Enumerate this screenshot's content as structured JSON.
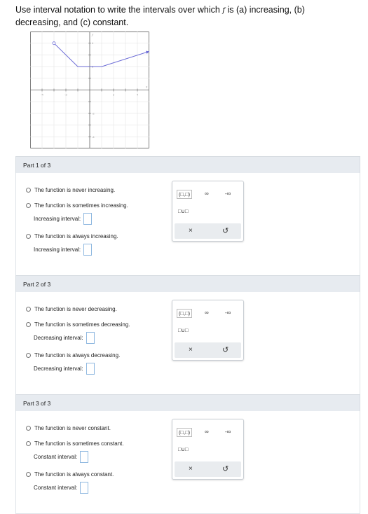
{
  "question": {
    "text_before": "Use interval notation to write the intervals over which ",
    "function_symbol": "f",
    "text_after": " is (a) increasing, (b) decreasing, and (c) constant."
  },
  "graph": {
    "x_axis_label": "x",
    "y_axis_label": "y",
    "x_range": [
      -5,
      5
    ],
    "y_range": [
      -5,
      5
    ],
    "curve_points": [
      [
        -3,
        4
      ],
      [
        -1,
        2
      ],
      [
        1,
        2
      ],
      [
        5,
        3.3
      ]
    ],
    "x_tick_labels": [
      "-4",
      "-2",
      "2",
      "4"
    ],
    "y_tick_labels": [
      "4",
      "2",
      "-2",
      "-4"
    ],
    "curve_color": "#6b6bd6",
    "open_endpoint": [
      -3,
      4
    ],
    "arrow_end": true
  },
  "parts": [
    {
      "header": "Part 1 of 3",
      "options": [
        "The function is never increasing.",
        "The function is sometimes increasing.",
        "The function is always increasing."
      ],
      "interval_labels": [
        "Increasing interval:",
        "Increasing interval:"
      ]
    },
    {
      "header": "Part 2 of 3",
      "options": [
        "The function is never decreasing.",
        "The function is sometimes decreasing.",
        "The function is always decreasing."
      ],
      "interval_labels": [
        "Decreasing interval:",
        "Decreasing interval:"
      ]
    },
    {
      "header": "Part 3 of 3",
      "options": [
        "The function is never constant.",
        "The function is sometimes constant.",
        "The function is always constant."
      ],
      "interval_labels": [
        "Constant interval:",
        "Constant interval:"
      ]
    }
  ],
  "palette": {
    "interval_button": "(□,□)",
    "infinity_button": "∞",
    "neg_infinity_button": "-∞",
    "union_button": "□∪□",
    "clear_button": "×",
    "undo_button": "↺"
  }
}
